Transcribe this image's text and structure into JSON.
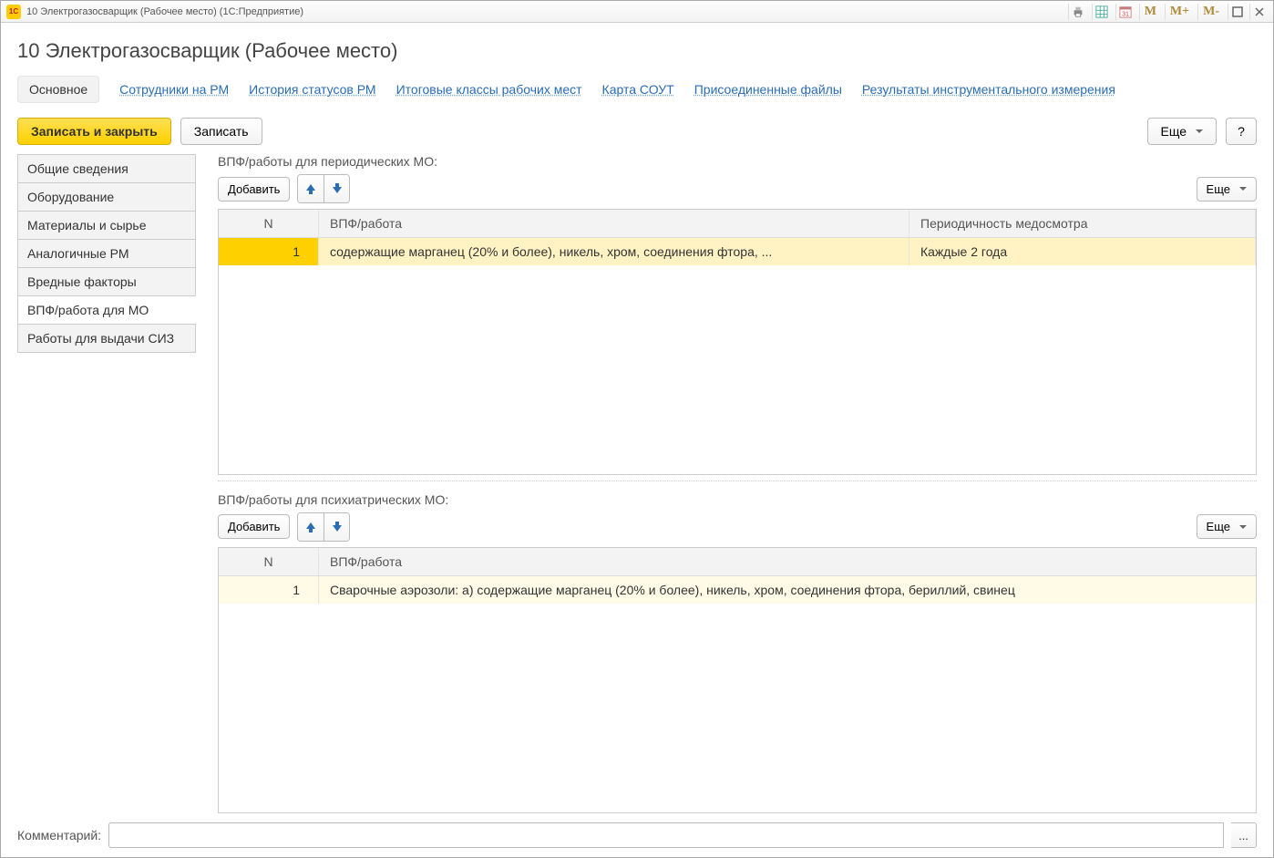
{
  "titlebar": {
    "logo_text": "1C",
    "title": "10 Электрогазосварщик (Рабочее место)  (1С:Предприятие)",
    "buttons": {
      "m": "M",
      "m_plus": "M+",
      "m_minus": "M-"
    }
  },
  "page_title": "10 Электрогазосварщик (Рабочее место)",
  "section_nav": [
    "Основное",
    "Сотрудники на РМ",
    "История статусов РМ",
    "Итоговые классы рабочих мест",
    "Карта СОУТ",
    "Присоединенные файлы",
    "Результаты инструментального измерения"
  ],
  "actions": {
    "save_close": "Записать и закрыть",
    "save": "Записать",
    "more": "Еще",
    "help": "?"
  },
  "side_tabs": [
    "Общие сведения",
    "Оборудование",
    "Материалы и сырье",
    "Аналогичные РМ",
    "Вредные факторы",
    "ВПФ/работа для МО",
    "Работы для выдачи СИЗ"
  ],
  "side_tabs_active_index": 5,
  "periodic": {
    "label": "ВПФ/работы для периодических МО:",
    "add": "Добавить",
    "more": "Еще",
    "columns": {
      "n": "N",
      "vpf": "ВПФ/работа",
      "per": "Периодичность медосмотра"
    },
    "rows": [
      {
        "n": "1",
        "vpf": "содержащие марганец (20% и более), никель, хром, соединения фтора, ...",
        "per": "Каждые 2 года"
      }
    ]
  },
  "psych": {
    "label": "ВПФ/работы для психиатрических МО:",
    "add": "Добавить",
    "more": "Еще",
    "columns": {
      "n": "N",
      "vpf": "ВПФ/работа"
    },
    "rows": [
      {
        "n": "1",
        "vpf": "Сварочные аэрозоли: а) содержащие марганец (20% и более), никель, хром, соединения фтора, бериллий, свинец"
      }
    ]
  },
  "comment": {
    "label": "Комментарий:",
    "value": "",
    "pick": "..."
  },
  "icons": {
    "arrow_up": "⬆",
    "arrow_down": "⬇"
  }
}
